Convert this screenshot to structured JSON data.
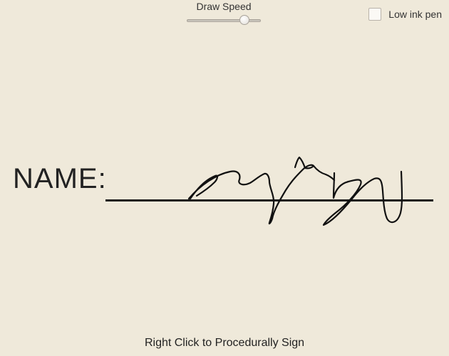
{
  "controls": {
    "draw_speed_label": "Draw Speed",
    "draw_speed_value": 0.78,
    "low_ink_label": "Low ink pen",
    "low_ink_checked": false
  },
  "signing": {
    "name_label": "NAME:"
  },
  "footer": {
    "hint": "Right Click to Procedurally Sign"
  },
  "colors": {
    "background": "#efe9da",
    "ink": "#111111"
  }
}
